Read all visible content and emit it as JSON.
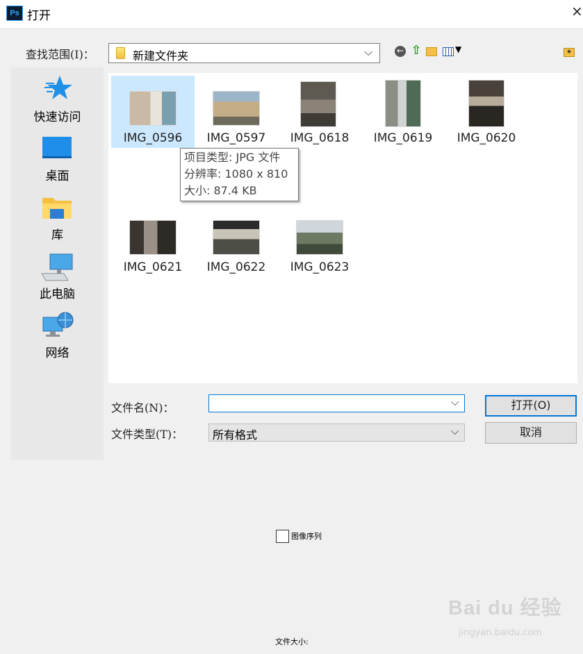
{
  "window": {
    "app_icon": "photoshop-icon",
    "title": "打开",
    "close_glyph": "×"
  },
  "toolbar": {
    "lookin_label": "查找范围(I)：",
    "lookin_value": "新建文件夹",
    "icons": [
      "back-icon",
      "up-folder-icon",
      "new-folder-icon",
      "view-menu-icon",
      "favorite-folder-icon"
    ]
  },
  "places": [
    {
      "label": "快速访问",
      "icon": "quick-access-star-icon"
    },
    {
      "label": "桌面",
      "icon": "desktop-icon"
    },
    {
      "label": "库",
      "icon": "library-folder-icon"
    },
    {
      "label": "此电脑",
      "icon": "computer-icon"
    },
    {
      "label": "网络",
      "icon": "network-icon"
    }
  ],
  "files": [
    {
      "name": "IMG_0596",
      "selected": true
    },
    {
      "name": "IMG_0597"
    },
    {
      "name": "IMG_0618"
    },
    {
      "name": "IMG_0619"
    },
    {
      "name": "IMG_0620"
    },
    {
      "name": "IMG_0621"
    },
    {
      "name": "IMG_0622"
    },
    {
      "name": "IMG_0623"
    }
  ],
  "tooltip": {
    "type": "项目类型: JPG 文件",
    "resolution": "分辨率: 1080 x 810",
    "size": "大小: 87.4 KB"
  },
  "form": {
    "filename_label": "文件名(N)：",
    "filename_value": "",
    "filetype_label": "文件类型(T)：",
    "filetype_value": "所有格式",
    "open_label": "打开(O)",
    "cancel_label": "取消",
    "sequence_label": "图像序列",
    "filesize_label": "文件大小:"
  },
  "watermark": {
    "brand": "Bai du 经验",
    "url": "jingyan.baidu.com"
  },
  "colors": {
    "selection": "#cce8ff",
    "accent": "#0078d7",
    "background": "#f0f0f0"
  }
}
